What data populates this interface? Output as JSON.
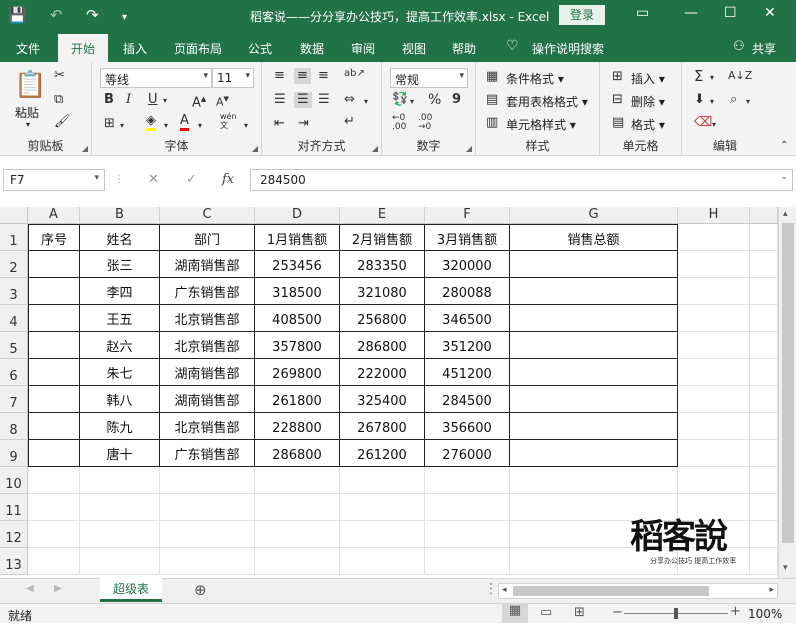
{
  "window": {
    "title": "稻客说——分分享办公技巧，提高工作效率.xlsx  -  Excel",
    "login_label": "登录"
  },
  "ribbon_tabs": [
    "文件",
    "开始",
    "插入",
    "页面布局",
    "公式",
    "数据",
    "审阅",
    "视图",
    "帮助",
    "操作说明搜索",
    "共享"
  ],
  "ribbon": {
    "paste_label": "粘贴",
    "clipboard_label": "剪贴板",
    "font_name": "等线",
    "font_size": "11",
    "font_label": "字体",
    "wen_label": "wén",
    "align_label": "对齐方式",
    "number_format": "常规",
    "percent": "%",
    "comma": "9",
    "number_label": "数字",
    "cond_format": "条件格式",
    "table_format": "套用表格格式",
    "cell_style": "单元格样式",
    "styles_label": "样式",
    "insert_label": "插入",
    "delete_label": "删除",
    "format_label": "格式",
    "cells_label": "单元格",
    "edit_label": "编辑"
  },
  "formula_bar": {
    "name_box": "F7",
    "fx": "fx",
    "value": "284500"
  },
  "sheet": {
    "columns": [
      "A",
      "B",
      "C",
      "D",
      "E",
      "F",
      "G",
      "H"
    ],
    "rows": [
      "1",
      "2",
      "3",
      "4",
      "5",
      "6",
      "7",
      "8",
      "9",
      "10",
      "11",
      "12",
      "13"
    ],
    "header": [
      "序号",
      "姓名",
      "部门",
      "1月销售额",
      "2月销售额",
      "3月销售额",
      "销售总额"
    ],
    "data": [
      [
        "",
        "张三",
        "湖南销售部",
        "253456",
        "283350",
        "320000",
        ""
      ],
      [
        "",
        "李四",
        "广东销售部",
        "318500",
        "321080",
        "280088",
        ""
      ],
      [
        "",
        "王五",
        "北京销售部",
        "408500",
        "256800",
        "346500",
        ""
      ],
      [
        "",
        "赵六",
        "北京销售部",
        "357800",
        "286800",
        "351200",
        ""
      ],
      [
        "",
        "朱七",
        "湖南销售部",
        "269800",
        "222000",
        "451200",
        ""
      ],
      [
        "",
        "韩八",
        "湖南销售部",
        "261800",
        "325400",
        "284500",
        ""
      ],
      [
        "",
        "陈九",
        "北京销售部",
        "228800",
        "267800",
        "356600",
        ""
      ],
      [
        "",
        "唐十",
        "广东销售部",
        "286800",
        "261200",
        "276000",
        ""
      ]
    ]
  },
  "sheet_tabs": {
    "active": "超级表"
  },
  "status": {
    "ready": "就绪",
    "zoom": "100%"
  },
  "watermark": {
    "brand": "稻客說",
    "tagline": "分享办公技巧  提高工作效率"
  },
  "colors": {
    "accent": "#217346"
  }
}
